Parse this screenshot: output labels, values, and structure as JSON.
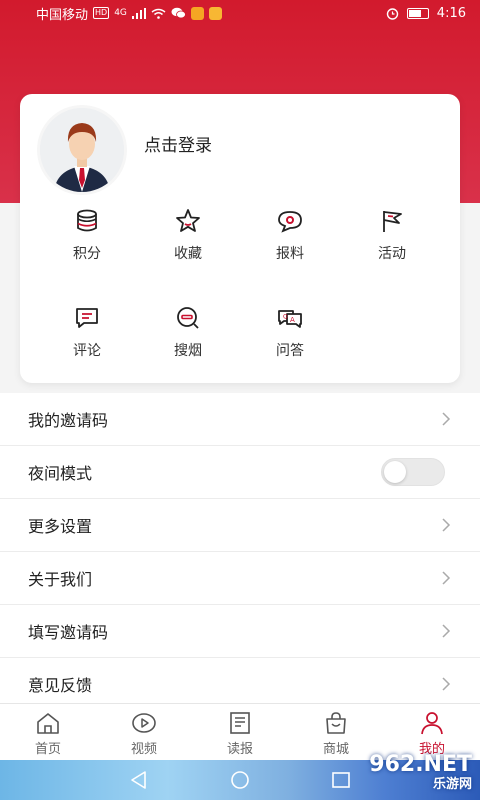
{
  "status_bar": {
    "carrier": "中国移动",
    "network_badge": "HD",
    "signal": "4G",
    "time": "4:16"
  },
  "profile": {
    "login_prompt": "点击登录"
  },
  "quick_actions": [
    {
      "label": "积分",
      "icon": "database-icon"
    },
    {
      "label": "收藏",
      "icon": "star-icon"
    },
    {
      "label": "报料",
      "icon": "chat-eye-icon"
    },
    {
      "label": "活动",
      "icon": "flag-icon"
    },
    {
      "label": "评论",
      "icon": "comment-icon"
    },
    {
      "label": "搜烟",
      "icon": "search-cigarette-icon"
    },
    {
      "label": "问答",
      "icon": "qa-icon"
    }
  ],
  "settings_list": [
    {
      "label": "我的邀请码",
      "control": "chevron"
    },
    {
      "label": "夜间模式",
      "control": "toggle",
      "toggle_on": false
    },
    {
      "label": "更多设置",
      "control": "chevron"
    },
    {
      "label": "关于我们",
      "control": "chevron"
    },
    {
      "label": "填写邀请码",
      "control": "chevron"
    },
    {
      "label": "意见反馈",
      "control": "chevron"
    }
  ],
  "tabbar": {
    "active": "我的",
    "items": [
      {
        "label": "首页",
        "icon": "home-icon"
      },
      {
        "label": "视频",
        "icon": "video-icon"
      },
      {
        "label": "读报",
        "icon": "newspaper-icon"
      },
      {
        "label": "商城",
        "icon": "shopping-bag-icon"
      },
      {
        "label": "我的",
        "icon": "user-icon"
      }
    ]
  },
  "watermark": {
    "brand": "962.NET",
    "sub": "乐游网"
  },
  "colors": {
    "accent": "#c8102e",
    "hero_red": "#d21a2d"
  }
}
